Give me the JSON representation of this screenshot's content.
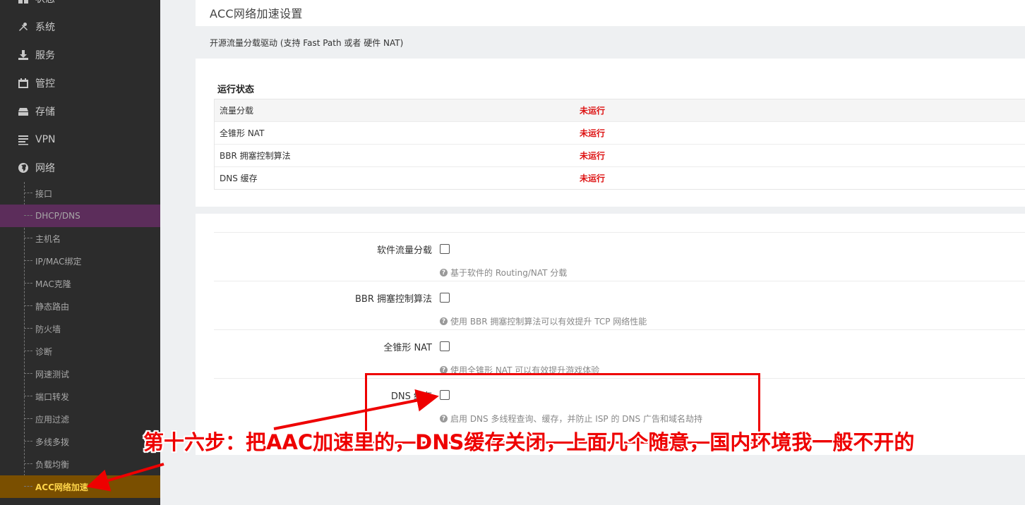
{
  "sidebar": {
    "menu": [
      {
        "label": "状态",
        "icon": "dashboard-icon"
      },
      {
        "label": "系统",
        "icon": "wrench-icon"
      },
      {
        "label": "服务",
        "icon": "download-icon"
      },
      {
        "label": "管控",
        "icon": "calendar-icon"
      },
      {
        "label": "存储",
        "icon": "storage-icon"
      },
      {
        "label": "VPN",
        "icon": "list-icon"
      },
      {
        "label": "网络",
        "icon": "globe-icon"
      }
    ],
    "submenu": [
      {
        "label": "接口"
      },
      {
        "label": "DHCP/DNS"
      },
      {
        "label": "主机名"
      },
      {
        "label": "IP/MAC绑定"
      },
      {
        "label": "MAC克隆"
      },
      {
        "label": "静态路由"
      },
      {
        "label": "防火墙"
      },
      {
        "label": "诊断"
      },
      {
        "label": "网速测试"
      },
      {
        "label": "端口转发"
      },
      {
        "label": "应用过滤"
      },
      {
        "label": "多线多拨"
      },
      {
        "label": "负载均衡"
      },
      {
        "label": "ACC网络加速"
      }
    ],
    "active_submenu": "DHCP/DNS",
    "current_submenu": "ACC网络加速"
  },
  "page": {
    "title": "ACC网络加速设置",
    "description": "开源流量分载驱动 (支持 Fast Path 或者 硬件 NAT)"
  },
  "status": {
    "heading": "运行状态",
    "rows": [
      {
        "name": "流量分载",
        "state": "未运行"
      },
      {
        "name": "全锥形 NAT",
        "state": "未运行"
      },
      {
        "name": "BBR 拥塞控制算法",
        "state": "未运行"
      },
      {
        "name": "DNS 缓存",
        "state": "未运行"
      }
    ]
  },
  "options": [
    {
      "label": "软件流量分载",
      "help": "基于软件的 Routing/NAT 分载",
      "checked": false
    },
    {
      "label": "BBR 拥塞控制算法",
      "help": "使用 BBR 拥塞控制算法可以有效提升 TCP 网络性能",
      "checked": false
    },
    {
      "label": "全锥形 NAT",
      "help": "使用全锥形 NAT 可以有效提升游戏体验",
      "checked": false
    },
    {
      "label": "DNS 缓存",
      "help": "启用 DNS 多线程查询、缓存，并防止 ISP 的 DNS 广告和域名劫持",
      "checked": false
    }
  ],
  "annotation": {
    "text": "第十六步：把AAC加速里的，DNS缓存关闭，上面几个随意，国内环境我一般不开的",
    "color": "#e00000"
  },
  "colors": {
    "sidebar_bg": "#2c2c2c",
    "active_bg": "#5c2d5b",
    "current_bg": "#7a4f00",
    "current_text": "#ffd54a",
    "status_red": "#dd1111"
  }
}
